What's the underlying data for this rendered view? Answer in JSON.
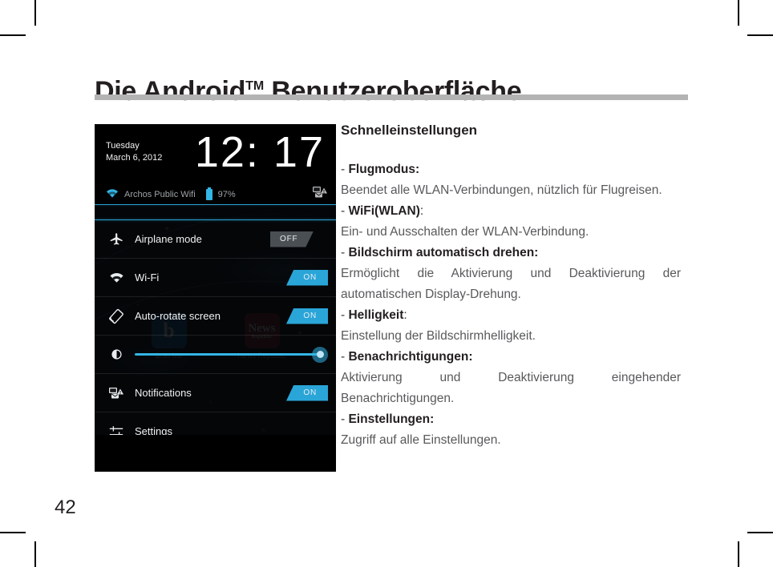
{
  "page": {
    "title_main_1": "Die Android",
    "title_tm": "TM",
    "title_main_2": " Benutzeroberfläche",
    "number": "42"
  },
  "screenshot": {
    "name": "android-quick-settings-screenshot",
    "status": {
      "weekday": "Tuesday",
      "date": "March 6, 2012",
      "clock": "12: 17",
      "wifi_ssid": "Archos Public Wifi",
      "battery_percent": "97%",
      "notification_icon": "notification-mail-warning-icon"
    },
    "home_apps": [
      {
        "label": "Brief Me",
        "glyph": "b",
        "icon": "brief-me-app-icon"
      },
      {
        "label": "News Republic",
        "glyph": "News",
        "sub": "Republic",
        "icon": "news-republic-app-icon"
      }
    ],
    "rows": [
      {
        "label": "Airplane mode",
        "icon": "airplane-icon",
        "control": "toggle",
        "state": "OFF"
      },
      {
        "label": "Wi-Fi",
        "icon": "wifi-icon",
        "control": "toggle",
        "state": "ON"
      },
      {
        "label": "Auto-rotate screen",
        "icon": "auto-rotate-icon",
        "control": "toggle",
        "state": "ON"
      },
      {
        "label": "",
        "icon": "brightness-icon",
        "control": "slider",
        "state": "100"
      },
      {
        "label": "Notifications",
        "icon": "notifications-icon",
        "control": "toggle",
        "state": "ON"
      },
      {
        "label": "Settings",
        "icon": "settings-sliders-icon",
        "control": "none",
        "state": ""
      }
    ],
    "colors": {
      "accent": "#33b5e5",
      "toggle_on": "#2aa5d8",
      "toggle_off": "#4a4f54"
    }
  },
  "body": {
    "heading": "Schnelleinstellungen",
    "entries": [
      {
        "bullet": "- ",
        "term": "Flugmodus:",
        "term_suffix": "",
        "desc": "Beendet alle WLAN-Verbindungen, nützlich für Flugreisen."
      },
      {
        "bullet": "- ",
        "term": "WiFi(WLAN)",
        "term_suffix": ":",
        "desc": "Ein- und  Ausschalten der WLAN-Verbindung."
      },
      {
        "bullet": "- ",
        "term": "Bildschirm automatisch drehen:",
        "term_suffix": "",
        "desc": "Ermöglicht die Aktivierung und Deaktivierung der automatischen Display-Drehung."
      },
      {
        "bullet": "- ",
        "term": "Helligkeit",
        "term_suffix": ":",
        "desc": "Einstellung der Bildschirmhelligkeit."
      },
      {
        "bullet": "- ",
        "term": "Benachrichtigungen:",
        "term_suffix": "",
        "desc": "Aktivierung und Deaktivierung eingehender Benachrichtigungen."
      },
      {
        "bullet": "- ",
        "term": "Einstellungen:",
        "term_suffix": "",
        "desc": "Zugriff auf alle Einstellungen."
      }
    ]
  }
}
